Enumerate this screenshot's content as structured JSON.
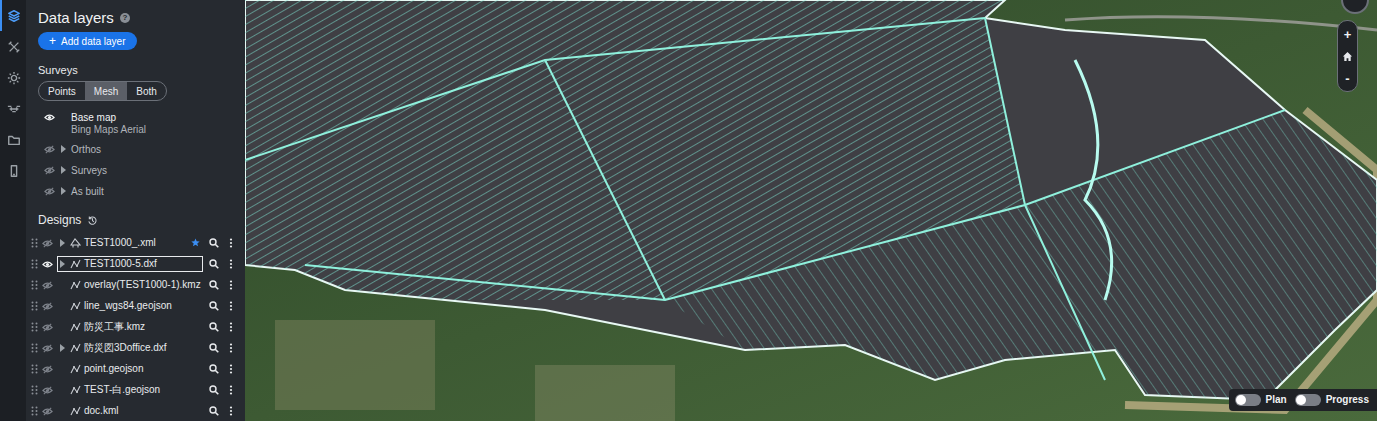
{
  "rail": [
    {
      "selected": true
    },
    {
      "selected": false
    },
    {
      "selected": false
    },
    {
      "selected": false
    },
    {
      "selected": false
    },
    {
      "selected": false
    }
  ],
  "panel": {
    "title": "Data layers",
    "help": "?",
    "add_button": {
      "icon": "+",
      "label": "Add data layer"
    }
  },
  "surveys": {
    "title": "Surveys",
    "modes": [
      {
        "label": "Points",
        "selected": false
      },
      {
        "label": "Mesh",
        "selected": true
      },
      {
        "label": "Both",
        "selected": false
      }
    ],
    "layers": [
      {
        "name": "Base map",
        "subtitle": "Bing Maps Aerial",
        "visible": true,
        "expandable": false
      },
      {
        "name": "Orthos",
        "subtitle": "",
        "visible": false,
        "expandable": true
      },
      {
        "name": "Surveys",
        "subtitle": "",
        "visible": false,
        "expandable": true
      },
      {
        "name": "As built",
        "subtitle": "",
        "visible": false,
        "expandable": true
      }
    ]
  },
  "designs": {
    "title": "Designs",
    "items": [
      {
        "name": "TEST1000_.xml",
        "kind": "surface",
        "visible": false,
        "expandable": true,
        "starred": true,
        "selected": false
      },
      {
        "name": "TEST1000-5.dxf",
        "kind": "linework",
        "visible": true,
        "expandable": true,
        "starred": false,
        "selected": true
      },
      {
        "name": "overlay(TEST1000-1).kmz",
        "kind": "linework",
        "visible": false,
        "expandable": false,
        "starred": false,
        "selected": false
      },
      {
        "name": "line_wgs84.geojson",
        "kind": "linework",
        "visible": false,
        "expandable": false,
        "starred": false,
        "selected": false
      },
      {
        "name": "防災工事.kmz",
        "kind": "linework",
        "visible": false,
        "expandable": false,
        "starred": false,
        "selected": false
      },
      {
        "name": "防災図3Doffice.dxf",
        "kind": "linework",
        "visible": false,
        "expandable": true,
        "starred": false,
        "selected": false
      },
      {
        "name": "point.geojson",
        "kind": "linework",
        "visible": false,
        "expandable": false,
        "starred": false,
        "selected": false
      },
      {
        "name": "TEST-白.geojson",
        "kind": "linework",
        "visible": false,
        "expandable": false,
        "starred": false,
        "selected": false
      },
      {
        "name": "doc.kml",
        "kind": "linework",
        "visible": false,
        "expandable": false,
        "starred": false,
        "selected": false
      }
    ]
  },
  "map": {
    "zoom_in": "+",
    "zoom_out": "-",
    "toggles": [
      {
        "label": "Plan",
        "on": false
      },
      {
        "label": "Progress",
        "on": false
      }
    ]
  }
}
